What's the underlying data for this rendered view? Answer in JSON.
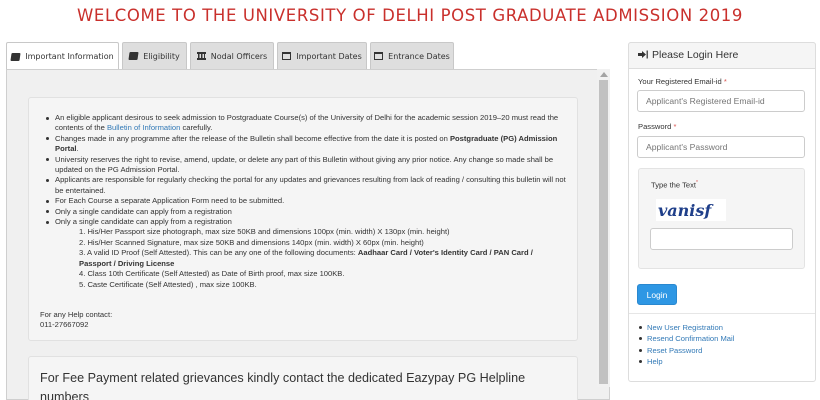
{
  "banner": {
    "title": "WELCOME TO THE UNIVERSITY OF DELHI POST GRADUATE ADMISSION 2019"
  },
  "tabs": [
    {
      "label": "Important Information",
      "icon": "book-icon",
      "active": true
    },
    {
      "label": "Eligibility",
      "icon": "book-icon",
      "active": false
    },
    {
      "label": "Nodal Officers",
      "icon": "bank-icon",
      "active": false
    },
    {
      "label": "Important Dates",
      "icon": "calendar-icon",
      "active": false
    },
    {
      "label": "Entrance Dates",
      "icon": "calendar-icon",
      "active": false
    }
  ],
  "info": {
    "item1_pre": "An eligible applicant desirous to seek admission to Postgraduate Course(s) of the University of Delhi for the academic session 2019–20 must read the contents of the ",
    "item1_link": "Bulletin of Information",
    "item1_post": " carefully.",
    "item2_pre": "Changes made in any programme after the release of the Bulletin shall become effective from the date it is posted on ",
    "item2_bold": "Postgraduate (PG) Admission Portal",
    "item2_post": ".",
    "item3": "University reserves the right to revise, amend, update, or delete any part of this Bulletin without giving any prior notice. Any change so made shall be updated on the PG Admission Portal.",
    "item4": "Applicants are responsible for regularly checking the portal for any updates and grievances resulting from lack of reading / consulting this bulletin will not be entertained.",
    "item5": "For Each Course a separate Application Form need to be submitted.",
    "item6": "Only a single candidate can apply from a registration",
    "item7": "Only a single candidate can apply from a registration",
    "sub1": "1. His/Her Passport size photograph, max size 50KB and dimensions 100px (min. width) X 130px (min. height)",
    "sub2": "2. His/Her Scanned Signature, max size 50KB and dimensions 140px (min. width) X 60px (min. height)",
    "sub3_pre": "3. A valid ID Proof (Self Attested). This can be any one of the following documents: ",
    "sub3_bold": "Aadhaar Card / Voter's Identity Card / PAN Card / Passport / Driving License",
    "sub4": "4. Class 10th Certificate (Self Attested) as Date of Birth proof, max size 100KB.",
    "sub5": "5. Caste Certificate (Self Attested) , max size 100KB.",
    "help_label": "For any Help contact:",
    "help_phone": "011-27667092"
  },
  "fee": {
    "text": "For Fee Payment related grievances kindly contact the dedicated Eazypay PG Helpline numbers"
  },
  "login": {
    "title": "Please Login Here",
    "email_label": "Your Registered Email-id",
    "email_placeholder": "Applicant's Registered Email-id",
    "password_label": "Password",
    "password_placeholder": "Applicant's Password",
    "captcha_label": "Type the Text",
    "captcha_text": "vanisf",
    "required_mark": "*",
    "button": "Login",
    "links": [
      "New User Registration",
      "Resend Confirmation Mail",
      "Reset Password",
      "Help"
    ]
  },
  "colors": {
    "banner": "#c9302c",
    "link": "#337ab7",
    "button": "#2e97e4"
  }
}
